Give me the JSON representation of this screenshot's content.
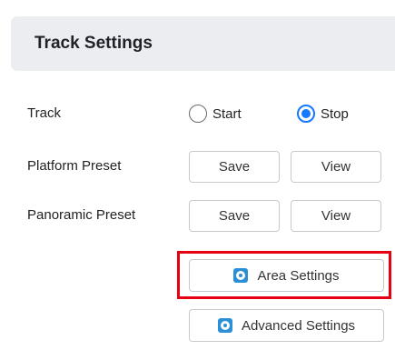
{
  "panel": {
    "title": "Track Settings"
  },
  "track": {
    "label": "Track",
    "options": [
      {
        "label": "Start",
        "checked": false
      },
      {
        "label": "Stop",
        "checked": true
      }
    ]
  },
  "platform_preset": {
    "label": "Platform Preset",
    "save": "Save",
    "view": "View"
  },
  "panoramic_preset": {
    "label": "Panoramic Preset",
    "save": "Save",
    "view": "View"
  },
  "area_settings": {
    "label": "Area Settings",
    "icon": "gear-icon"
  },
  "advanced_settings": {
    "label": "Advanced Settings",
    "icon": "gear-icon"
  },
  "colors": {
    "accent": "#1677ff",
    "highlight": "#e60012",
    "icon": "#2a8fd6"
  }
}
